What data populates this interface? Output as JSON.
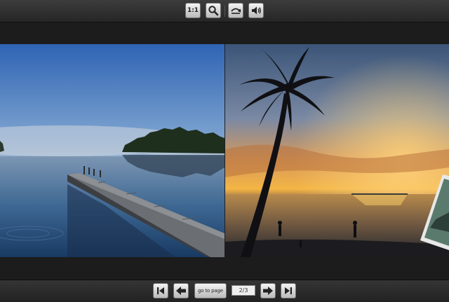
{
  "toolbar": {
    "actual_size_label": "1:1",
    "zoom_icon": "magnifier-icon",
    "flip_icon": "flip-arrow-icon",
    "sound_icon": "speaker-icon"
  },
  "gallery": {
    "left_photo": "lake-dock-photo",
    "right_photo": "palm-sunset-photo",
    "edge_photo": "partial-rotated-photo"
  },
  "navigation": {
    "first_icon": "skip-to-first-icon",
    "prev_icon": "arrow-left-icon",
    "goto_label": "go to page",
    "page_indicator": "2/3",
    "next_icon": "arrow-right-icon",
    "last_icon": "skip-to-last-icon"
  },
  "colors": {
    "toolbar_bg": "#2f2f2f",
    "button_face": "#dcdcdc",
    "stage_bg": "#1c1c1c"
  }
}
